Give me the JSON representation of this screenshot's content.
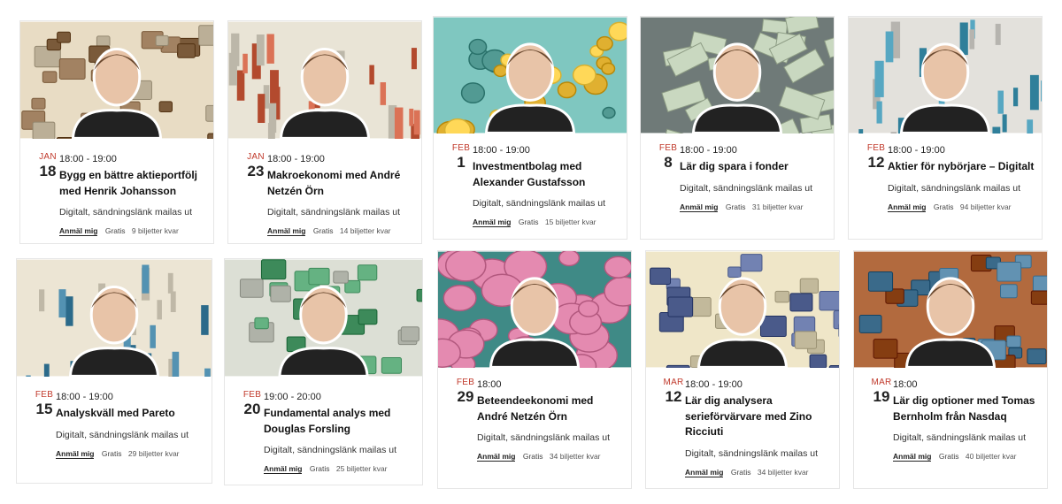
{
  "register_label": "Anmäl mig",
  "price_label": "Gratis",
  "events": [
    {
      "month": "JAN",
      "day": "18",
      "time": "18:00 - 19:00",
      "title": "Bygg en bättre aktieportfölj med Henrik Johansson",
      "location": "Digitalt, sändningslänk mailas ut",
      "tickets": "9 biljetter kvar",
      "image_theme": "briefcases",
      "colors": {
        "bg": "#e8dcc4",
        "accent": "#7a5a3a"
      }
    },
    {
      "month": "JAN",
      "day": "23",
      "time": "18:00 - 19:00",
      "title": "Makroekonomi med André Netzén Örn",
      "location": "Digitalt, sändningslänk mailas ut",
      "tickets": "14 biljetter kvar",
      "image_theme": "macro-charts",
      "colors": {
        "bg": "#e9e4d6",
        "accent": "#b34a2e"
      }
    },
    {
      "month": "FEB",
      "day": "1",
      "time": "18:00 - 19:00",
      "title": "Investmentbolag med Alexander Gustafsson",
      "location": "Digitalt, sändningslänk mailas ut",
      "tickets": "15 biljetter kvar",
      "image_theme": "gold-coins",
      "colors": {
        "bg": "#7fc7c0",
        "accent": "#e0b030"
      }
    },
    {
      "month": "FEB",
      "day": "8",
      "time": "18:00 - 19:00",
      "title": "Lär dig spara i fonder",
      "location": "Digitalt, sändningslänk mailas ut",
      "tickets": "31 biljetter kvar",
      "image_theme": "banknotes",
      "colors": {
        "bg": "#6f7a78",
        "accent": "#c9d8c0"
      }
    },
    {
      "month": "FEB",
      "day": "12",
      "time": "18:00 - 19:00",
      "title": "Aktier för nybörjare – Digitalt",
      "location": "Digitalt, sändningslänk mailas ut",
      "tickets": "94 biljetter kvar",
      "image_theme": "charts",
      "colors": {
        "bg": "#e3e1dc",
        "accent": "#2f7f9a"
      }
    },
    {
      "month": "FEB",
      "day": "15",
      "time": "18:00 - 19:00",
      "title": "Analyskväll med Pareto",
      "location": "Digitalt, sändningslänk mailas ut",
      "tickets": "29 biljetter kvar",
      "image_theme": "bar-charts",
      "colors": {
        "bg": "#ece5d4",
        "accent": "#2b6a8a"
      }
    },
    {
      "month": "FEB",
      "day": "20",
      "time": "19:00 - 20:00",
      "title": "Fundamental analys med Douglas Forsling",
      "location": "Digitalt, sändningslänk mailas ut",
      "tickets": "25 biljetter kvar",
      "image_theme": "spreadsheets",
      "colors": {
        "bg": "#dcdfd5",
        "accent": "#3d8a5a"
      }
    },
    {
      "month": "FEB",
      "day": "29",
      "time": "18:00",
      "title": "Beteendeekonomi med André Netzén Örn",
      "location": "Digitalt, sändningslänk mailas ut",
      "tickets": "34 biljetter kvar",
      "image_theme": "brains",
      "colors": {
        "bg": "#3f8a86",
        "accent": "#e48ab0"
      }
    },
    {
      "month": "MAR",
      "day": "12",
      "time": "18:00 - 19:00",
      "title": "Lär dig analysera serieförvärvare med Zino Ricciuti",
      "location": "Digitalt, sändningslänk mailas ut",
      "tickets": "34 biljetter kvar",
      "image_theme": "calculators",
      "colors": {
        "bg": "#efe6c8",
        "accent": "#4a5a8a"
      }
    },
    {
      "month": "MAR",
      "day": "19",
      "time": "18:00",
      "title": "Lär dig optioner med Tomas Bernholm från Nasdaq",
      "location": "Digitalt, sändningslänk mailas ut",
      "tickets": "40 biljetter kvar",
      "image_theme": "trading-screens",
      "colors": {
        "bg": "#b26a3e",
        "accent": "#3a6a8a"
      }
    }
  ]
}
